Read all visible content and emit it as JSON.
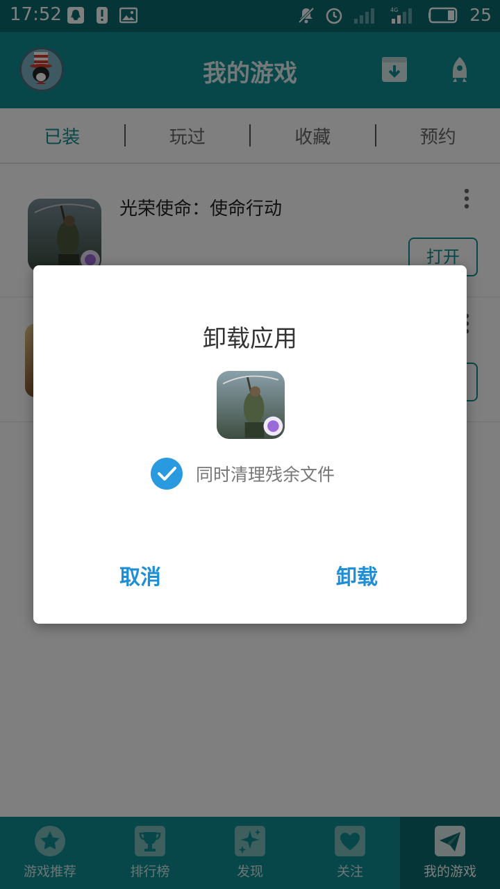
{
  "status_bar": {
    "time": "17:52",
    "battery": "25"
  },
  "header": {
    "title": "我的游戏"
  },
  "tabs": [
    {
      "label": "已装",
      "active": true
    },
    {
      "label": "玩过",
      "active": false
    },
    {
      "label": "收藏",
      "active": false
    },
    {
      "label": "预约",
      "active": false
    }
  ],
  "games": [
    {
      "name": "光荣使命：使命行动",
      "action": "打开"
    }
  ],
  "dialog": {
    "title": "卸载应用",
    "checkbox_label": "同时清理残余文件",
    "checkbox_checked": true,
    "cancel_label": "取消",
    "confirm_label": "卸载"
  },
  "bottom_nav": [
    {
      "label": "游戏推荐",
      "icon": "star-icon"
    },
    {
      "label": "排行榜",
      "icon": "trophy-icon"
    },
    {
      "label": "发现",
      "icon": "sparkle-icon"
    },
    {
      "label": "关注",
      "icon": "heart-icon"
    },
    {
      "label": "我的游戏",
      "icon": "paper-plane-icon",
      "active": true
    }
  ],
  "colors": {
    "status_bar": "#0b6b6d",
    "header": "#0f8f92",
    "accent": "#0f8f92",
    "dialog_button": "#1e8ed6",
    "check": "#2a9ae0"
  }
}
